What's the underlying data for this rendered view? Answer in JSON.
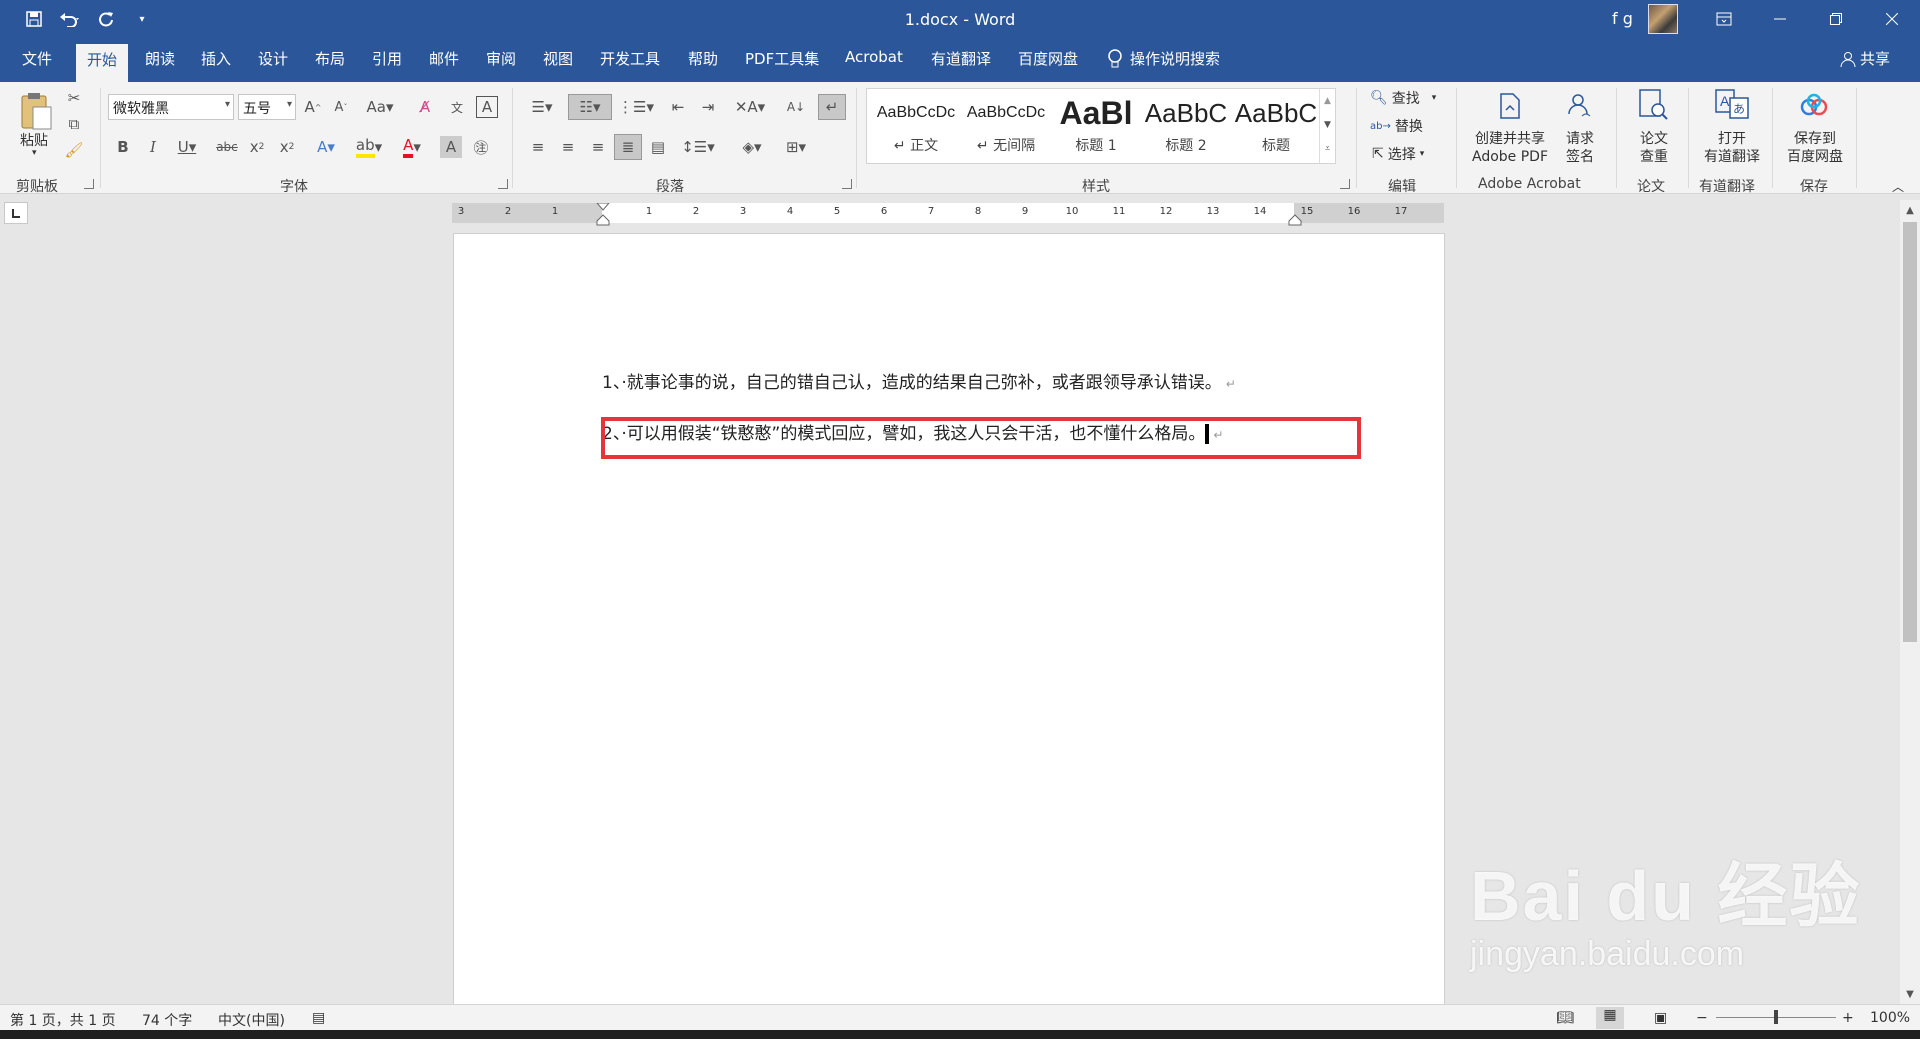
{
  "window": {
    "doc_title": "1.docx  -  Word",
    "user": "f g"
  },
  "tabs": [
    "文件",
    "开始",
    "朗读",
    "插入",
    "设计",
    "布局",
    "引用",
    "邮件",
    "审阅",
    "视图",
    "开发工具",
    "帮助",
    "PDF工具集",
    "Acrobat",
    "有道翻译",
    "百度网盘"
  ],
  "tell_me": "操作说明搜索",
  "share": "共享",
  "ribbon": {
    "clipboard": {
      "paste": "粘贴",
      "label": "剪贴板"
    },
    "font": {
      "name": "微软雅黑",
      "size": "五号",
      "label": "字体"
    },
    "paragraph": {
      "label": "段落"
    },
    "styles": {
      "label": "样式",
      "items": [
        {
          "sample": "AaBbCcDc",
          "name": "↵ 正文"
        },
        {
          "sample": "AaBbCcDc",
          "name": "↵ 无间隔"
        },
        {
          "sample": "AaBl",
          "name": "标题 1"
        },
        {
          "sample": "AaBbC",
          "name": "标题 2"
        },
        {
          "sample": "AaBbC",
          "name": "标题"
        }
      ]
    },
    "editing": {
      "find": "查找",
      "replace": "替换",
      "select": "选择",
      "label": "编辑"
    },
    "acrobat": {
      "create_line1": "创建并共享",
      "create_line2": "Adobe PDF",
      "sign_line1": "请求",
      "sign_line2": "签名",
      "label": "Adobe Acrobat"
    },
    "paper": {
      "check_line1": "论文",
      "check_line2": "查重",
      "label": "论文"
    },
    "youdao": {
      "open_line1": "打开",
      "open_line2": "有道翻译",
      "label": "有道翻译"
    },
    "save": {
      "line1": "保存到",
      "line2": "百度网盘",
      "label": "保存"
    }
  },
  "ruler": {
    "numbers": [
      "3",
      "2",
      "1",
      "1",
      "2",
      "3",
      "4",
      "5",
      "6",
      "7",
      "8",
      "9",
      "10",
      "11",
      "12",
      "13",
      "14",
      "15",
      "16",
      "17"
    ]
  },
  "document": {
    "paragraphs": [
      "1、·就事论事的说，自己的错自己认，造成的结果自己弥补，或者跟领导承认错误。",
      "2、·可以用假装“铁憨憨”的模式回应，譬如，我这人只会干活，也不懂什么格局。"
    ],
    "para_mark": "↵"
  },
  "status": {
    "page": "第 1 页，共 1 页",
    "words": "74 个字",
    "language": "中文(中国)",
    "zoom": "100%"
  },
  "watermark": {
    "logo": "Bai du 经验",
    "url": "jingyan.baidu.com"
  },
  "colors": {
    "title_bar": "#2b579a",
    "highlight": "#e8333a"
  }
}
